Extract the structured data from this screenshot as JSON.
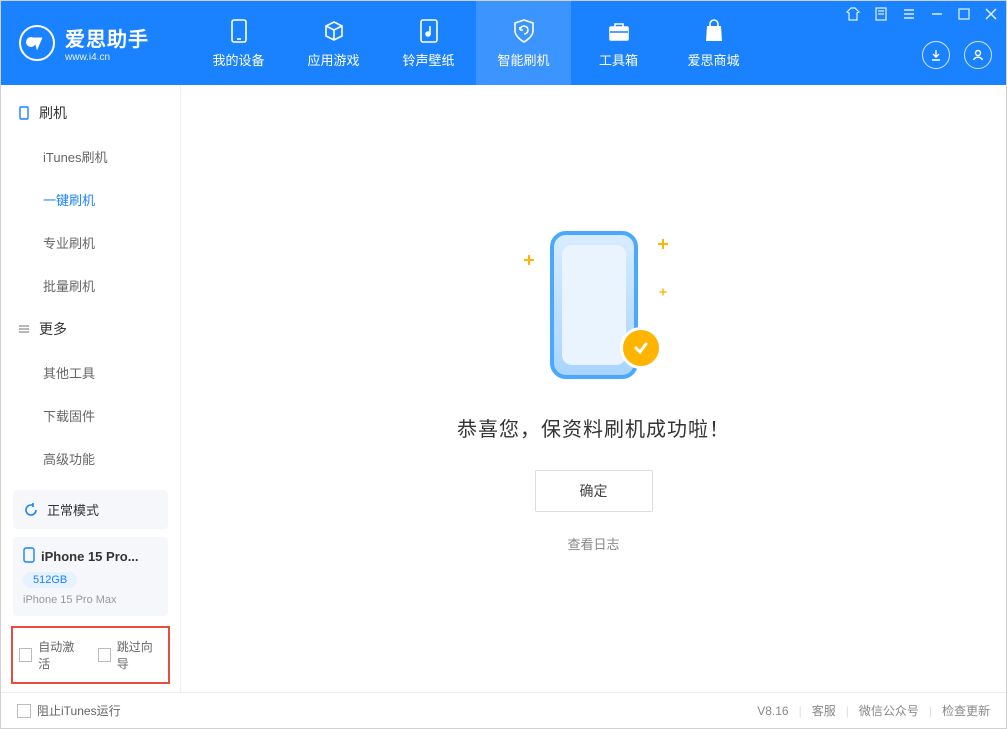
{
  "app": {
    "title": "爱思助手",
    "subtitle": "www.i4.cn"
  },
  "nav": {
    "items": [
      {
        "label": "我的设备"
      },
      {
        "label": "应用游戏"
      },
      {
        "label": "铃声壁纸"
      },
      {
        "label": "智能刷机"
      },
      {
        "label": "工具箱"
      },
      {
        "label": "爱思商城"
      }
    ]
  },
  "sidebar": {
    "group1": {
      "title": "刷机",
      "items": [
        "iTunes刷机",
        "一键刷机",
        "专业刷机",
        "批量刷机"
      ]
    },
    "group2": {
      "title": "更多",
      "items": [
        "其他工具",
        "下载固件",
        "高级功能"
      ]
    },
    "mode": "正常模式",
    "device": {
      "name": "iPhone 15 Pro...",
      "storage": "512GB",
      "model": "iPhone 15 Pro Max"
    },
    "auto_activate": "自动激活",
    "skip_guide": "跳过向导"
  },
  "main": {
    "success_text": "恭喜您，保资料刷机成功啦！",
    "ok_button": "确定",
    "view_log": "查看日志"
  },
  "footer": {
    "block_itunes": "阻止iTunes运行",
    "version": "V8.16",
    "links": [
      "客服",
      "微信公众号",
      "检查更新"
    ]
  }
}
